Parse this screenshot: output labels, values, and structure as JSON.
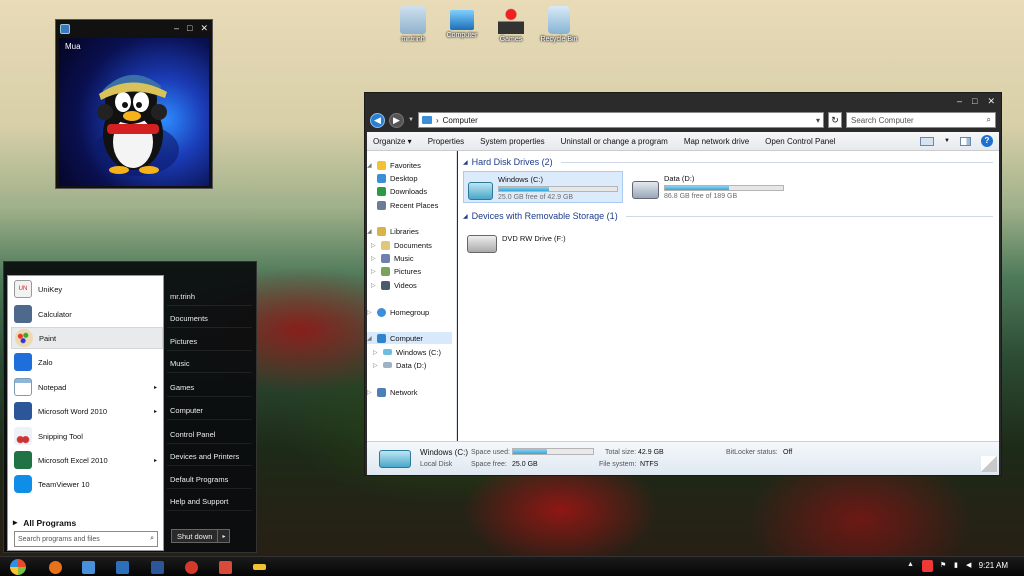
{
  "desktop": {
    "icons": [
      {
        "label": "mr.trinh",
        "icon": "user-folder-icon"
      },
      {
        "label": "Computer",
        "icon": "computer-icon"
      },
      {
        "label": "Games",
        "icon": "joystick-icon"
      },
      {
        "label": "Recycle Bin",
        "icon": "recycle-bin-icon"
      }
    ]
  },
  "mua": {
    "label": "Mua",
    "controls": [
      "–",
      "□",
      "✕"
    ]
  },
  "explorer": {
    "controls": [
      "–",
      "□",
      "✕"
    ],
    "address": {
      "arrow": "›",
      "location": "Computer"
    },
    "search_placeholder": "Search Computer",
    "toolbar": {
      "organize": "Organize ▾",
      "properties": "Properties",
      "system_properties": "System properties",
      "uninstall": "Uninstall or change a program",
      "map_drive": "Map network drive",
      "control_panel": "Open Control Panel",
      "help": "?"
    },
    "nav": {
      "favorites": "Favorites",
      "desktop": "Desktop",
      "downloads": "Downloads",
      "recent": "Recent Places",
      "libraries": "Libraries",
      "documents": "Documents",
      "music": "Music",
      "pictures": "Pictures",
      "videos": "Videos",
      "homegroup": "Homegroup",
      "computer": "Computer",
      "windows_c": "Windows (C:)",
      "data_d": "Data (D:)",
      "network": "Network"
    },
    "groups": {
      "hdd": "Hard Disk Drives (2)",
      "removable": "Devices with Removable Storage (1)"
    },
    "drives": [
      {
        "name": "Windows (C:)",
        "free": "25.0 GB free of 42.9 GB",
        "used_fraction": 0.42
      },
      {
        "name": "Data (D:)",
        "free": "86.8 GB free of 189 GB",
        "used_fraction": 0.54
      }
    ],
    "dvd": {
      "name": "DVD RW Drive (F:)"
    },
    "details": {
      "name": "Windows (C:)",
      "type": "Local Disk",
      "space_used_label": "Space used:",
      "used_fraction": 0.42,
      "space_free_label": "Space free:",
      "space_free": "25.0 GB",
      "total_size_label": "Total size:",
      "total_size": "42.9 GB",
      "fs_label": "File system:",
      "fs": "NTFS",
      "bitlocker_label": "BitLocker status:",
      "bitlocker": "Off"
    }
  },
  "start_menu": {
    "programs": [
      {
        "label": "UniKey",
        "color": "#f2f2f2"
      },
      {
        "label": "Calculator",
        "color": "#4d6a8c"
      },
      {
        "label": "Paint",
        "color": "#e9a43a"
      },
      {
        "label": "Zalo",
        "color": "#1e6fdc"
      },
      {
        "label": "Notepad",
        "color": "#8fb6d8"
      },
      {
        "label": "Microsoft Word 2010",
        "color": "#2b579a"
      },
      {
        "label": "Snipping Tool",
        "color": "#c33b3b"
      },
      {
        "label": "Microsoft Excel 2010",
        "color": "#217346"
      },
      {
        "label": "TeamViewer 10",
        "color": "#0e8ee9"
      }
    ],
    "chevron": "▸",
    "all_programs": "All Programs",
    "all_arrow": "▸",
    "search_placeholder": "Search programs and files",
    "right_links": [
      "mr.trinh",
      "Documents",
      "Pictures",
      "Music",
      "Games",
      "Computer",
      "Control Panel",
      "Devices and Printers",
      "Default Programs",
      "Help and Support"
    ],
    "shutdown": "Shut down",
    "shutdown_arrow": "▸"
  },
  "taskbar": {
    "time": "9:21 AM",
    "tray_up": "▲",
    "colors": {
      "start": "#2f6fd6",
      "firefox": "#e8721c",
      "files": "#4a8fd9",
      "player": "#2d6fb8",
      "word": "#2b579a",
      "chrome": "#d33a2c",
      "paint": "#d84a3a",
      "app": "#f2c230",
      "vivaldi": "#ef3939"
    }
  }
}
